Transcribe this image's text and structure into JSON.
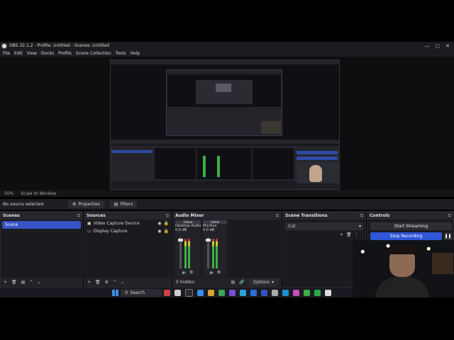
{
  "window": {
    "title": "OBS 32.1.2 - Profile: Untitled - Scenes: Untitled",
    "controls": [
      "—",
      "▢",
      "✕"
    ]
  },
  "menu": [
    "File",
    "Edit",
    "View",
    "Docks",
    "Profile",
    "Scene Collection",
    "Tools",
    "Help"
  ],
  "zoom": {
    "value": "50%",
    "mode": "Scale to Window"
  },
  "context": {
    "status": "No source selected",
    "properties_label": "Properties",
    "filters_label": "Filters"
  },
  "docks": {
    "scenes": {
      "title": "Scenes",
      "items": [
        "Scene"
      ]
    },
    "sources": {
      "title": "Sources",
      "items": [
        "Video Capture Device",
        "Display Capture"
      ]
    },
    "mixer": {
      "title": "Audio Mixer",
      "channels": [
        {
          "name": "Desktop Audio",
          "level": "0.0 dB",
          "tag": "Global"
        },
        {
          "name": "Mic/Aux",
          "level": "0.0 dB",
          "tag": "Global"
        }
      ],
      "hidden_label": "0 hidden",
      "options_label": "Options"
    },
    "transitions": {
      "title": "Scene Transitions",
      "selected": "Cut"
    },
    "controls": {
      "title": "Controls",
      "start_streaming": "Start Streaming",
      "stop_recording": "Stop Recording"
    }
  },
  "taskbar": {
    "search": "Search"
  },
  "colors": {
    "accent": "#2f56d6",
    "selected": "#3553c4",
    "bg": "#1b1b1f"
  }
}
